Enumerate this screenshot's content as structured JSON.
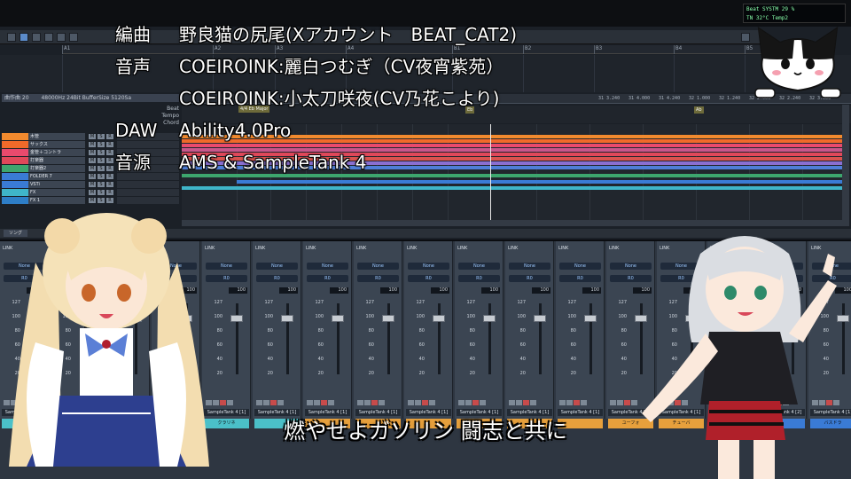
{
  "credits": [
    {
      "key": "編曲",
      "value": "野良猫の尻尾(Xアカウント　BEAT_CAT2)"
    },
    {
      "key": "音声",
      "value": "COEIROINK:麗白つむぎ（CV夜宵紫苑）"
    },
    {
      "key": "",
      "value": "COEIROINK:小太刀咲夜(CV乃花こより)"
    },
    {
      "key": "DAW",
      "value": "Ability4.0Pro"
    },
    {
      "key": "音源",
      "value": "AMS & SampleTank 4"
    }
  ],
  "lyric": "燃やせよガソリン 闘志と共に",
  "daw": {
    "ruler_marks": [
      "A1",
      "A2",
      "A3",
      "A4",
      "B1",
      "B2",
      "B3",
      "B4",
      "B5"
    ],
    "info_strip": [
      "曲作曲 20",
      "48000Hz 24Bit BufferSize 5120Sa"
    ],
    "timeline_labels": [
      "31 3.240",
      "31 4.000",
      "31 4.240",
      "32 1.000",
      "32 1.240",
      "32 2.000",
      "32 2.240",
      "32 3.000"
    ],
    "header_rows": [
      "Beat",
      "Tempo",
      "Chord"
    ],
    "marker_flags": [
      "4/4 Eb Major",
      "Eb",
      "Ab"
    ],
    "tracks": [
      {
        "name": "木管",
        "color": "#f28a2e"
      },
      {
        "name": "サックス",
        "color": "#f06a2a"
      },
      {
        "name": "金管＋コントラ",
        "color": "#e94a6d"
      },
      {
        "name": "打楽器",
        "color": "#e0485a"
      },
      {
        "name": "打楽器2",
        "color": "#3da66e"
      },
      {
        "name": "FOLDER 7",
        "color": "#3a7bd5"
      },
      {
        "name": "VSTi",
        "color": "#3a7bd5"
      },
      {
        "name": "FX",
        "color": "#3fb5c9"
      },
      {
        "name": "FX 1",
        "color": "#2e7ec7"
      }
    ],
    "track_buttons": [
      "M",
      "S",
      "R"
    ],
    "song_tab": "ソング",
    "readout_lines": [
      "Beat  SYSTM  29 %",
      "TN  32°C  Temp2",
      "0:1 74:A  CPU"
    ]
  },
  "mixer": {
    "link_label": "LINK",
    "input_label": "None",
    "output_label": "R0",
    "pan_value": "100",
    "scale": [
      "127",
      "100",
      "80",
      "60",
      "40",
      "20"
    ],
    "channel_names": [
      "SampleTank 4 [1]",
      "SampleTank 4 [1]",
      "SampleTank 4 [1]",
      "SampleTank 4 [1]",
      "SampleTank 4 [1]",
      "SampleTank 4 [1]",
      "SampleTank 4 [1]",
      "SampleTank 4 [1]",
      "SampleTank 4 [1]",
      "SampleTank 4 [1]",
      "SampleTank 4 [1]",
      "SampleTank 4 [1]",
      "SampleTank 4 [1]",
      "SampleTank 4 [1]",
      "SampleTank 4 [1]",
      "SampleTank 4 [2]",
      "SampleTank 4 [1]"
    ],
    "channel_colors": [
      {
        "label": "",
        "color": "#4bc0c8"
      },
      {
        "label": "",
        "color": "#4bc0c8"
      },
      {
        "label": "",
        "color": "#4bc0c8"
      },
      {
        "label": "ロット",
        "color": "#4bc0c8"
      },
      {
        "label": "クラリネ",
        "color": "#4bc0c8"
      },
      {
        "label": "",
        "color": "#4bc0c8"
      },
      {
        "label": "",
        "color": "#e7a03c"
      },
      {
        "label": "",
        "color": "#e7a03c"
      },
      {
        "label": "",
        "color": "#e7a03c"
      },
      {
        "label": "",
        "color": "#e7a03c"
      },
      {
        "label": "",
        "color": "#e7a03c"
      },
      {
        "label": "",
        "color": "#e7a03c"
      },
      {
        "label": "ユーフォ",
        "color": "#e7a03c"
      },
      {
        "label": "チューバ",
        "color": "#e7a03c"
      },
      {
        "label": "",
        "color": "#e7a03c"
      },
      {
        "label": "",
        "color": "#3a7bd5"
      },
      {
        "label": "バスドラ",
        "color": "#3a7bd5"
      }
    ],
    "fader_levels": [
      100,
      100,
      100,
      100,
      100,
      100,
      100,
      100,
      100,
      100,
      100,
      100,
      100,
      100,
      100,
      100,
      100
    ]
  }
}
